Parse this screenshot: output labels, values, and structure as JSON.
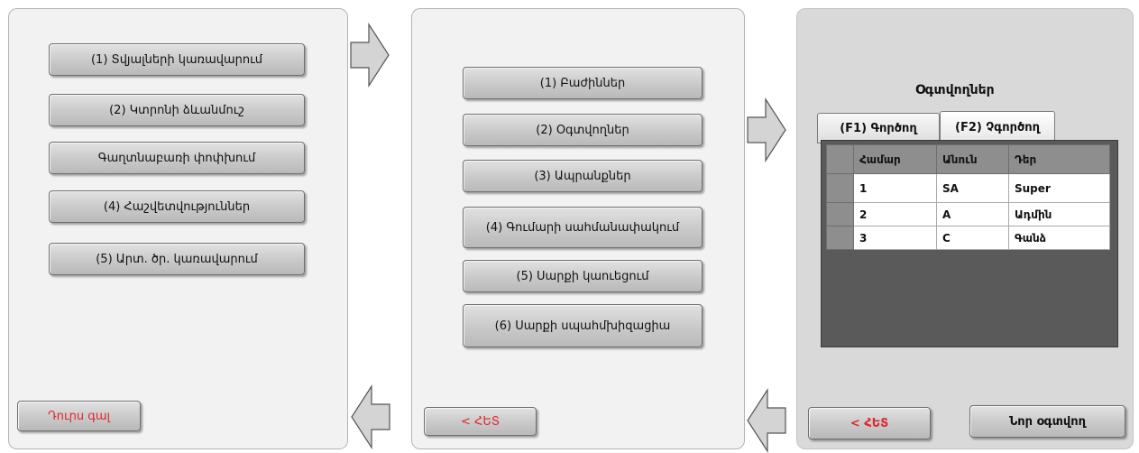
{
  "colors": {
    "accent_red": "#e2262b",
    "panel_bg": "#f2f2f2",
    "panel3_bg": "#d9d9d9",
    "grid_bg": "#5a5a5a"
  },
  "panel1": {
    "buttons": [
      "(1) Տվյալների կառավարում",
      "(2) Կտրոնի ձևանմուշ",
      "Գաղտնաբառի փոփխում",
      "(4) Հաշվետվություններ",
      "(5) Արտ. ծր. կառավարում"
    ],
    "exit_label": "Դուրս գալ"
  },
  "panel2": {
    "buttons": [
      "(1) Բաժիններ",
      "(2) Օգտվողներ",
      "(3) Ապրանքներ",
      "(4) Գումարի սահմանափակում",
      "(5) Սարքի կաուեցում",
      "(6) Սարքի սպահմխիզացիա"
    ],
    "back_label": "< ՀԵՏ"
  },
  "panel3": {
    "title": "Օգտվողներ",
    "tabs": [
      "(F1) Գործող",
      "(F2) Չգործող"
    ],
    "table": {
      "headers": [
        "Համար",
        "Անուն",
        "Դեր"
      ],
      "rows": [
        [
          "1",
          "SA",
          "Super"
        ],
        [
          "2",
          "A",
          "Ադմին"
        ],
        [
          "3",
          "C",
          "Գանձ"
        ]
      ]
    },
    "back_label": "< ՀԵՏ",
    "new_user_label": "Նոր օգտվող"
  },
  "icons": [
    "arrow-right-icon",
    "arrow-right-icon",
    "arrow-left-icon",
    "arrow-left-icon"
  ]
}
